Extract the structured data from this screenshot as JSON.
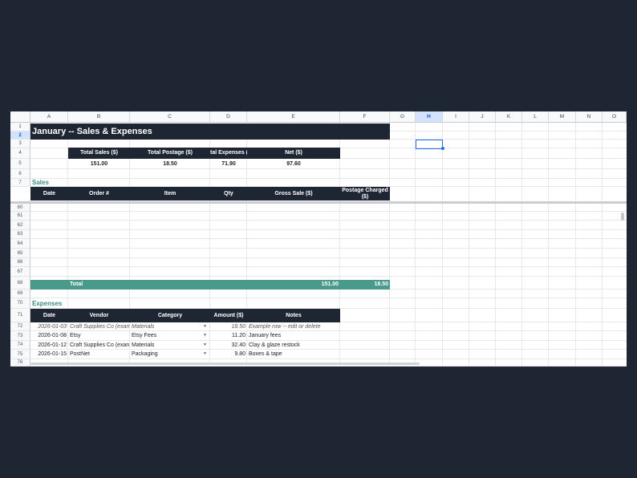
{
  "columns": [
    "A",
    "B",
    "C",
    "D",
    "E",
    "F",
    "G",
    "H",
    "I",
    "J",
    "K",
    "L",
    "M",
    "N",
    "O"
  ],
  "selected_column": "H",
  "rows_top": [
    "1",
    "2",
    "3",
    "4",
    "5",
    "6",
    "7"
  ],
  "rows_bottom": [
    "60",
    "61",
    "62",
    "63",
    "64",
    "65",
    "66",
    "67",
    "68",
    "69",
    "70",
    "71",
    "72",
    "73",
    "74",
    "75",
    "76"
  ],
  "selected_row": "2",
  "title": "January -- Sales & Expenses",
  "summary": {
    "headers": [
      "Total Sales ($)",
      "Total Postage ($)",
      "tal Expenses (",
      "Net ($)"
    ],
    "values": [
      "151.00",
      "18.50",
      "71.90",
      "97.60"
    ]
  },
  "sales": {
    "section_label": "Sales",
    "headers": [
      "Date",
      "Order #",
      "Item",
      "Qty",
      "Gross Sale ($)",
      "Postage Charged ($)"
    ],
    "total_label": "Total",
    "total_gross": "151.00",
    "total_postage": "18.50"
  },
  "expenses": {
    "section_label": "Expenses",
    "headers": [
      "Date",
      "Vendor",
      "Category",
      "Amount ($)",
      "Notes"
    ],
    "rows": [
      {
        "date": "2026-01-03",
        "vendor": "Craft Supplies Co (exampl",
        "category": "Materials",
        "amount": "18.50",
        "notes": "Example row -- edit or delete",
        "example": true
      },
      {
        "date": "2026-01-08",
        "vendor": "Etsy",
        "category": "Etsy Fees",
        "amount": "11.20",
        "notes": "January fees",
        "example": false
      },
      {
        "date": "2026-01-12",
        "vendor": "Craft Supplies Co (exan",
        "category": "Materials",
        "amount": "32.40",
        "notes": "Clay & glaze restock",
        "example": false
      },
      {
        "date": "2026-01-15",
        "vendor": "PostNet",
        "category": "Packaging",
        "amount": "9.80",
        "notes": "Boxes & tape",
        "example": false
      }
    ]
  },
  "dropdown_icon": "triangle-down-icon",
  "colors": {
    "dark": "#1f2633",
    "teal": "#4a9a8c",
    "section": "#3a8f83",
    "select": "#1a73e8"
  }
}
